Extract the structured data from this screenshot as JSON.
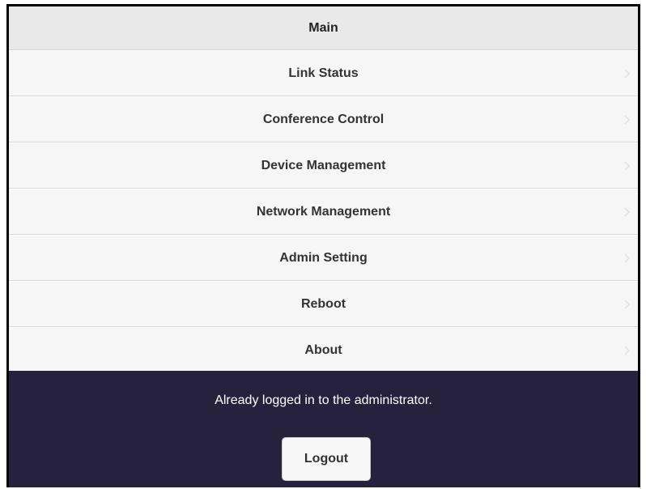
{
  "header": {
    "title": "Main"
  },
  "menu": {
    "items": [
      {
        "label": "Link Status"
      },
      {
        "label": "Conference Control"
      },
      {
        "label": "Device Management"
      },
      {
        "label": "Network Management"
      },
      {
        "label": "Admin Setting"
      },
      {
        "label": "Reboot"
      },
      {
        "label": "About"
      }
    ]
  },
  "footer": {
    "message": "Already logged in to the administrator.",
    "logout_label": "Logout"
  },
  "colors": {
    "footer_bg": "#26223e",
    "header_bg": "#e9e9e9",
    "item_bg": "#f6f6f6"
  },
  "icons": {
    "menu_item_icon": "chevron-right-icon"
  }
}
